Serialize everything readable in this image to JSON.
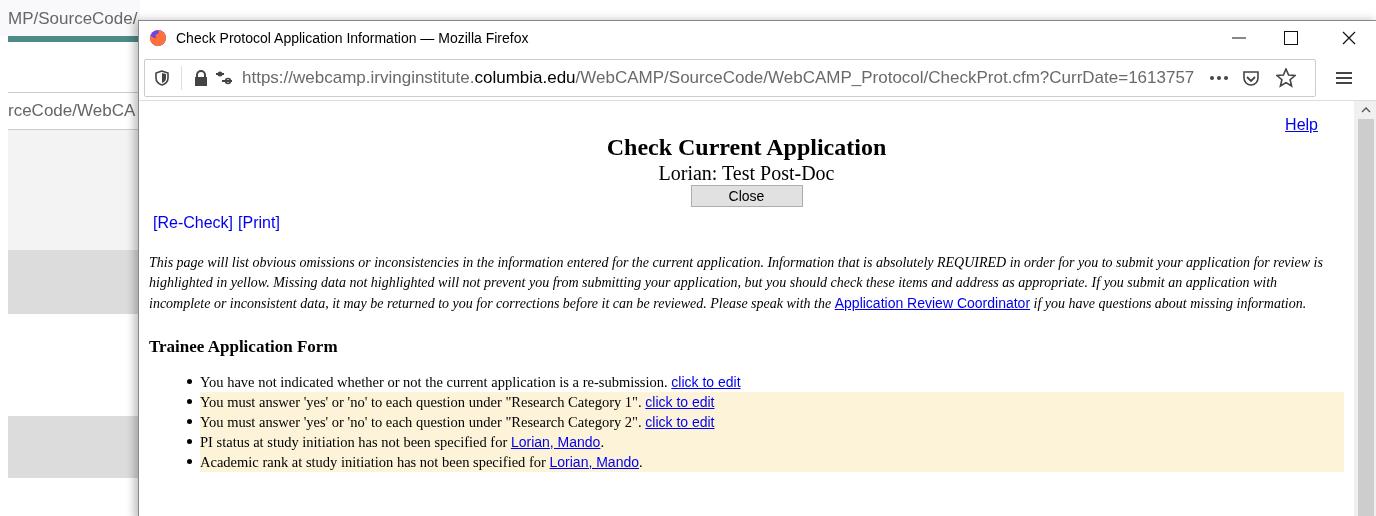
{
  "background_window": {
    "url_fragment": "MP/SourceCode/",
    "url_fragment_2": "rceCode/WebCA"
  },
  "window": {
    "title": "Check Protocol Application Information — Mozilla Firefox"
  },
  "address_bar": {
    "url_prefix": "https://webcamp.irvinginstitute.",
    "url_domain": "columbia.edu",
    "url_suffix": "/WebCAMP/SourceCode/WebCAMP_Protocol/CheckProt.cfm?CurrDate=1613757"
  },
  "help_link": "Help",
  "heading": "Check Current Application",
  "subheading": "Lorian: Test Post-Doc",
  "close_button": "Close",
  "actions": [
    "[Re-Check]",
    "[Print]"
  ],
  "intro": {
    "before": "This page will list obvious omissions or inconsistencies in the information entered for the current application. Information that is absolutely REQUIRED in order for you to submit your application for review is highlighted in yellow. Missing data not highlighted will not prevent you from submitting your application, but you should check these items and address as appropriate. If you submit an application with incomplete or inconsistent data, it may be returned to you for corrections before it can be reviewed. Please speak with the",
    "link": "Application Review Coordinator",
    "after": "if you have questions about missing information."
  },
  "section_title": "Trainee Application Form",
  "items": [
    {
      "text": "You have not indicated whether or not the current application is a re-submission.",
      "link": "click to edit",
      "highlighted": false
    },
    {
      "text": "You must answer 'yes' or 'no' to each question under \"Research Category 1\".",
      "link": "click to edit",
      "highlighted": true
    },
    {
      "text": "You must answer 'yes' or 'no' to each question under \"Research Category 2\".",
      "link": "click to edit",
      "highlighted": true
    },
    {
      "text": "PI status at study initiation has not been specified for",
      "link": "Lorian, Mando",
      "suffix": ".",
      "highlighted": true
    },
    {
      "text": "Academic rank at study initiation has not been specified for",
      "link": "Lorian, Mando",
      "suffix": ".",
      "highlighted": true
    }
  ]
}
